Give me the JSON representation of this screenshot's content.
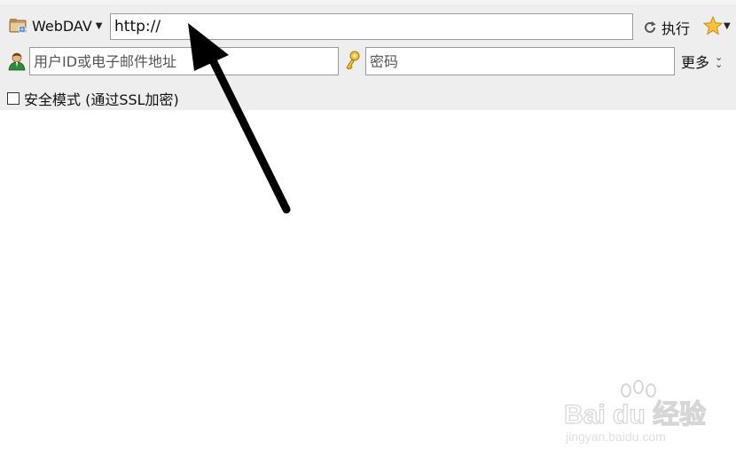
{
  "toolbar": {
    "protocol": {
      "label": "WebDAV",
      "icon": "folder-network-icon"
    },
    "url": {
      "value": "http://"
    },
    "execute": {
      "label": "执行",
      "icon": "refresh-icon"
    },
    "favorites": {
      "icon": "star-icon"
    },
    "user_field": {
      "placeholder": "用户ID或电子邮件地址",
      "icon": "user-icon"
    },
    "password_field": {
      "placeholder": "密码",
      "icon": "key-icon"
    },
    "more": {
      "label": "更多"
    },
    "secure_mode": {
      "label": "安全模式 (通过SSL加密)",
      "checked": false
    }
  },
  "watermark": {
    "brand": "Bai du 经验",
    "url": "jingyan.baidu.com"
  },
  "colors": {
    "toolbar_bg": "#eeeeee",
    "arrow": "#000000",
    "star": "#f5a623"
  }
}
